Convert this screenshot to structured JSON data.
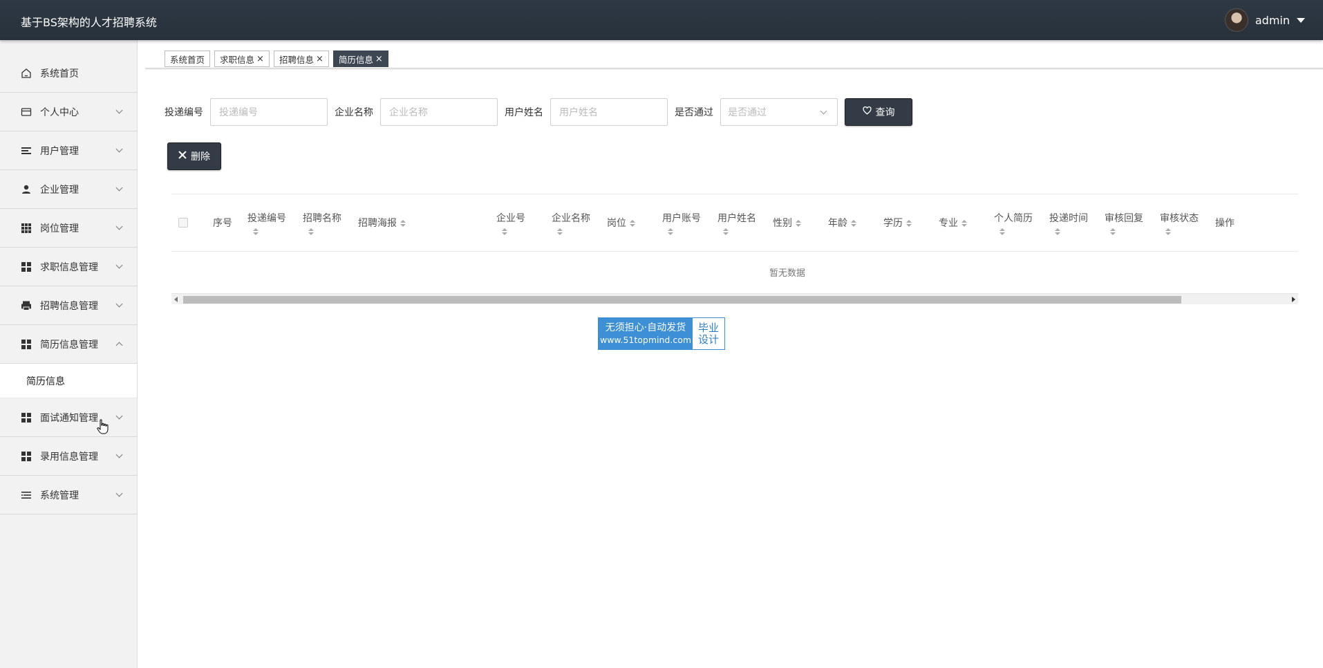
{
  "header": {
    "title": "基于BS架构的人才招聘系统",
    "username": "admin"
  },
  "sidebar": {
    "items": [
      {
        "label": "系统首页",
        "icon": "home-icon",
        "has_arrow": false
      },
      {
        "label": "个人中心",
        "icon": "card-icon",
        "has_arrow": true
      },
      {
        "label": "用户管理",
        "icon": "bars-icon",
        "has_arrow": true
      },
      {
        "label": "企业管理",
        "icon": "user-icon",
        "has_arrow": true
      },
      {
        "label": "岗位管理",
        "icon": "grid-icon",
        "has_arrow": true
      },
      {
        "label": "求职信息管理",
        "icon": "apps-icon",
        "has_arrow": true
      },
      {
        "label": "招聘信息管理",
        "icon": "printer-icon",
        "has_arrow": true
      },
      {
        "label": "简历信息管理",
        "icon": "apps-icon",
        "has_arrow": true,
        "expanded": true
      },
      {
        "label": "面试通知管理",
        "icon": "apps-icon",
        "has_arrow": true
      },
      {
        "label": "录用信息管理",
        "icon": "apps-icon",
        "has_arrow": true
      },
      {
        "label": "系统管理",
        "icon": "list-icon",
        "has_arrow": true
      }
    ],
    "subitem": "简历信息"
  },
  "tabs": [
    {
      "label": "系统首页",
      "closable": false,
      "active": false
    },
    {
      "label": "求职信息",
      "closable": true,
      "active": false
    },
    {
      "label": "招聘信息",
      "closable": true,
      "active": false
    },
    {
      "label": "简历信息",
      "closable": true,
      "active": true
    }
  ],
  "tab_close_glyph": "×",
  "search": {
    "fields": [
      {
        "label": "投递编号",
        "placeholder": "投递编号"
      },
      {
        "label": "企业名称",
        "placeholder": "企业名称"
      },
      {
        "label": "用户姓名",
        "placeholder": "用户姓名"
      }
    ],
    "select": {
      "label": "是否通过",
      "placeholder": "是否通过"
    },
    "query_label": "查询",
    "delete_label": "删除"
  },
  "table": {
    "columns": [
      "序号",
      "投递编号",
      "招聘名称",
      "招聘海报",
      "企业号",
      "企业名称",
      "岗位",
      "用户账号",
      "用户姓名",
      "性别",
      "年龄",
      "学历",
      "专业",
      "个人简历",
      "投递时间",
      "审核回复",
      "审核状态",
      "操作"
    ],
    "rows": [],
    "empty_text": "暂无数据"
  },
  "badge": {
    "line1": "无须担心·自动发货",
    "line2": "www.51topmind.com",
    "right1": "毕业",
    "right2": "设计"
  },
  "colors": {
    "header_bg": "#2e3945",
    "active_tab": "#3d4753",
    "button_dark": "#333c46",
    "badge_blue": "#3d8fd6"
  }
}
